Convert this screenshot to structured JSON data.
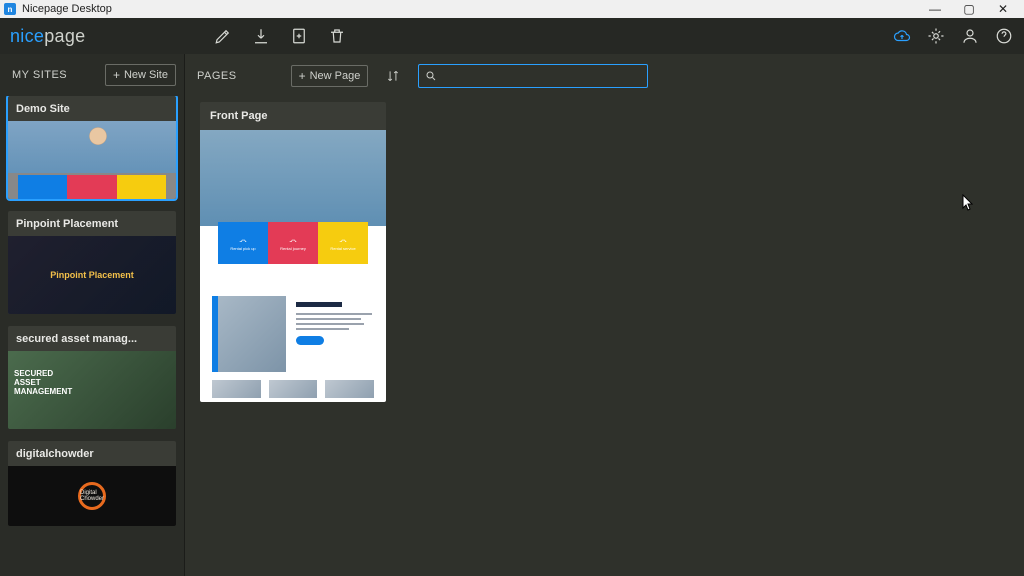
{
  "window": {
    "title": "Nicepage Desktop"
  },
  "logo": {
    "part1": "nice",
    "part2": "page"
  },
  "sidebar": {
    "title": "MY SITES",
    "new_site_label": "New Site",
    "sites": [
      {
        "name": "Demo Site",
        "selected": true
      },
      {
        "name": "Pinpoint Placement",
        "selected": false
      },
      {
        "name": "secured asset manag...",
        "selected": false
      },
      {
        "name": "digitalchowder",
        "selected": false
      }
    ],
    "pinpoint_overlay": "Pinpoint Placement",
    "secured_overlay": "SECURED\nASSET\nMANAGEMENT",
    "digital_overlay": "Digital Chowder"
  },
  "content": {
    "pages_title": "PAGES",
    "new_page_label": "New Page",
    "search_value": "",
    "pages": [
      {
        "name": "Front Page"
      }
    ]
  },
  "colors": {
    "accent": "#2aa0ff",
    "card_blue": "#0f7ee4",
    "card_red": "#e33b56",
    "card_yellow": "#f6cc0f"
  }
}
